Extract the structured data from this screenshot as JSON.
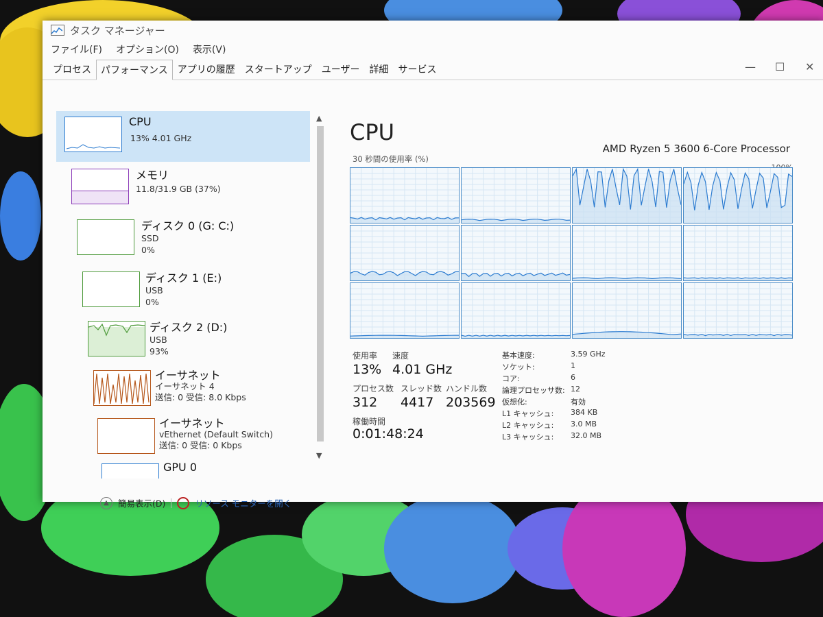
{
  "window": {
    "title": "タスク マネージャー",
    "controls": {
      "minimize": "—",
      "maximize": "☐",
      "close": "✕"
    }
  },
  "menu": [
    "ファイル(F)",
    "オプション(O)",
    "表示(V)"
  ],
  "tabs": [
    {
      "label": "プロセス",
      "active": false
    },
    {
      "label": "パフォーマンス",
      "active": true
    },
    {
      "label": "アプリの履歴",
      "active": false
    },
    {
      "label": "スタートアップ",
      "active": false
    },
    {
      "label": "ユーザー",
      "active": false
    },
    {
      "label": "詳細",
      "active": false
    },
    {
      "label": "サービス",
      "active": false
    }
  ],
  "resources": [
    {
      "name": "CPU",
      "sub": [
        "13%  4.01 GHz"
      ],
      "color": "#2b7bd0",
      "selected": true
    },
    {
      "name": "メモリ",
      "sub": [
        "11.8/31.9 GB (37%)"
      ],
      "color": "#8b3ab8"
    },
    {
      "name": "ディスク 0 (G: C:)",
      "sub": [
        "SSD",
        "0%"
      ],
      "color": "#4d9a3a"
    },
    {
      "name": "ディスク 1 (E:)",
      "sub": [
        "USB",
        "0%"
      ],
      "color": "#4d9a3a"
    },
    {
      "name": "ディスク 2 (D:)",
      "sub": [
        "USB",
        "93%"
      ],
      "color": "#4d9a3a"
    },
    {
      "name": "イーサネット",
      "sub": [
        "イーサネット 4",
        "送信: 0 受信: 8.0 Kbps"
      ],
      "color": "#b5561a"
    },
    {
      "name": "イーサネット",
      "sub": [
        "vEthernet (Default Switch)",
        "送信: 0 受信: 0 Kbps"
      ],
      "color": "#b5561a"
    },
    {
      "name": "GPU 0",
      "sub": [],
      "color": "#2b7bd0"
    }
  ],
  "cpu": {
    "title": "CPU",
    "model": "AMD Ryzen 5 3600 6-Core Processor",
    "graph_label": "30 秒間の使用率 (%)",
    "graph_max": "100%",
    "core_loads": [
      0.08,
      0.05,
      0.55,
      0.5,
      0.15,
      0.12,
      0.03,
      0.03,
      0.03,
      0.03,
      0.1,
      0.05
    ]
  },
  "stats": {
    "usage_label": "使用率",
    "usage": "13%",
    "speed_label": "速度",
    "speed": "4.01 GHz",
    "proc_label": "プロセス数",
    "proc": "312",
    "thread_label": "スレッド数",
    "thread": "4417",
    "handle_label": "ハンドル数",
    "handle": "203569",
    "uptime_label": "稼働時間",
    "uptime": "0:01:48:24"
  },
  "specs": [
    {
      "k": "基本速度:",
      "v": "3.59 GHz"
    },
    {
      "k": "ソケット:",
      "v": "1"
    },
    {
      "k": "コア:",
      "v": "6"
    },
    {
      "k": "論理プロセッサ数:",
      "v": "12"
    },
    {
      "k": "仮想化:",
      "v": "有効"
    },
    {
      "k": "L1 キャッシュ:",
      "v": "384 KB"
    },
    {
      "k": "L2 キャッシュ:",
      "v": "3.0 MB"
    },
    {
      "k": "L3 キャッシュ:",
      "v": "32.0 MB"
    }
  ],
  "footer": {
    "compact": "簡易表示(D)",
    "resmon": "リソース モニターを開く"
  }
}
